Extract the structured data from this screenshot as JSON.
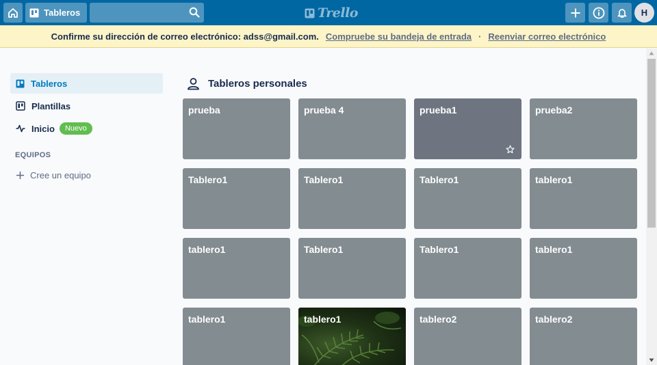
{
  "header": {
    "boards_label": "Tableros",
    "search_value": "",
    "logo_text": "Trello",
    "avatar_initial": "H"
  },
  "banner": {
    "message": "Confirme su dirección de correo electrónico: adss@gmail.com.",
    "check_inbox": "Compruebe su bandeja de entrada",
    "separator": "·",
    "resend": "Reenviar correo electrónico"
  },
  "sidebar": {
    "items": [
      {
        "label": "Tableros",
        "icon": "board-icon"
      },
      {
        "label": "Plantillas",
        "icon": "template-icon"
      },
      {
        "label": "Inicio",
        "icon": "activity-icon",
        "badge": "Nuevo"
      }
    ],
    "teams_title": "EQUIPOS",
    "create_team": "Cree un equipo"
  },
  "main": {
    "section_title": "Tableros personales",
    "boards": [
      {
        "name": "prueba"
      },
      {
        "name": "prueba 4"
      },
      {
        "name": "prueba1"
      },
      {
        "name": "prueba2"
      },
      {
        "name": "Tablero1"
      },
      {
        "name": "Tablero1"
      },
      {
        "name": "Tablero1"
      },
      {
        "name": "tablero1"
      },
      {
        "name": "tablero1"
      },
      {
        "name": "Tablero1"
      },
      {
        "name": "Tablero1"
      },
      {
        "name": "tablero1"
      },
      {
        "name": "tablero1"
      },
      {
        "name": "tablero1"
      },
      {
        "name": "tablero2"
      },
      {
        "name": "tablero2"
      }
    ]
  },
  "colors": {
    "header": "#0067a3",
    "banner": "#fdf4c7",
    "tile": "#838c91",
    "tile_hover": "#6e7580",
    "badge": "#61bd4f",
    "accent": "#0079bf"
  }
}
